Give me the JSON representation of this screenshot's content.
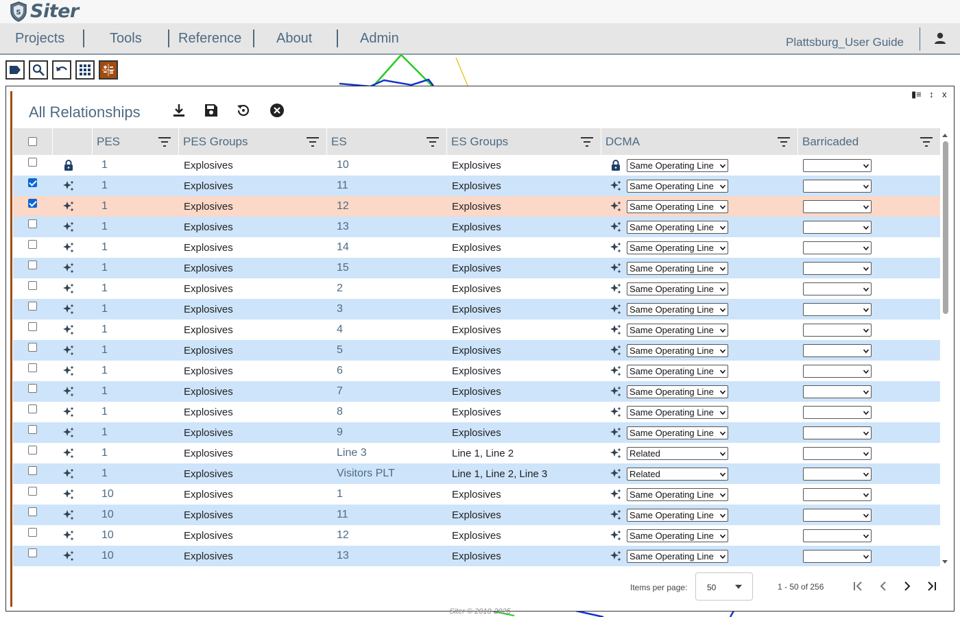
{
  "app": {
    "name": "Siter"
  },
  "nav": {
    "items": [
      "Projects",
      "Tools",
      "Reference",
      "About",
      "Admin"
    ],
    "project_name": "Plattsburg_User Guide"
  },
  "toolbar": {
    "tools": [
      "label-tool-icon",
      "search-icon",
      "undo-icon",
      "grid-icon",
      "calculator-icon"
    ]
  },
  "panel": {
    "title": "All Relationships",
    "controls": {
      "columns": "▮≡",
      "resize": "↕",
      "close": "x"
    },
    "actions": [
      "download-icon",
      "save-icon",
      "reset-icon",
      "cancel-icon"
    ]
  },
  "table": {
    "columns": [
      "PES",
      "PES Groups",
      "ES",
      "ES Groups",
      "DCMA",
      "Barricaded"
    ],
    "rows": [
      {
        "checked": false,
        "icon": "lock",
        "pes": "1",
        "pes_groups": "Explosives",
        "es": "10",
        "es_groups": "Explosives",
        "dcma_icon": "lock",
        "dcma": "Same Operating Line",
        "barricaded": ""
      },
      {
        "checked": true,
        "icon": "sparkle",
        "pes": "1",
        "pes_groups": "Explosives",
        "es": "11",
        "es_groups": "Explosives",
        "dcma_icon": "sparkle",
        "dcma": "Same Operating Line",
        "barricaded": ""
      },
      {
        "checked": true,
        "icon": "sparkle",
        "pes": "1",
        "pes_groups": "Explosives",
        "es": "12",
        "es_groups": "Explosives",
        "dcma_icon": "sparkle",
        "dcma": "Same Operating Line",
        "barricaded": "",
        "highlight": true
      },
      {
        "checked": false,
        "icon": "sparkle",
        "pes": "1",
        "pes_groups": "Explosives",
        "es": "13",
        "es_groups": "Explosives",
        "dcma_icon": "sparkle",
        "dcma": "Same Operating Line",
        "barricaded": ""
      },
      {
        "checked": false,
        "icon": "sparkle",
        "pes": "1",
        "pes_groups": "Explosives",
        "es": "14",
        "es_groups": "Explosives",
        "dcma_icon": "sparkle",
        "dcma": "Same Operating Line",
        "barricaded": ""
      },
      {
        "checked": false,
        "icon": "sparkle",
        "pes": "1",
        "pes_groups": "Explosives",
        "es": "15",
        "es_groups": "Explosives",
        "dcma_icon": "sparkle",
        "dcma": "Same Operating Line",
        "barricaded": ""
      },
      {
        "checked": false,
        "icon": "sparkle",
        "pes": "1",
        "pes_groups": "Explosives",
        "es": "2",
        "es_groups": "Explosives",
        "dcma_icon": "sparkle",
        "dcma": "Same Operating Line",
        "barricaded": ""
      },
      {
        "checked": false,
        "icon": "sparkle",
        "pes": "1",
        "pes_groups": "Explosives",
        "es": "3",
        "es_groups": "Explosives",
        "dcma_icon": "sparkle",
        "dcma": "Same Operating Line",
        "barricaded": ""
      },
      {
        "checked": false,
        "icon": "sparkle",
        "pes": "1",
        "pes_groups": "Explosives",
        "es": "4",
        "es_groups": "Explosives",
        "dcma_icon": "sparkle",
        "dcma": "Same Operating Line",
        "barricaded": ""
      },
      {
        "checked": false,
        "icon": "sparkle",
        "pes": "1",
        "pes_groups": "Explosives",
        "es": "5",
        "es_groups": "Explosives",
        "dcma_icon": "sparkle",
        "dcma": "Same Operating Line",
        "barricaded": ""
      },
      {
        "checked": false,
        "icon": "sparkle",
        "pes": "1",
        "pes_groups": "Explosives",
        "es": "6",
        "es_groups": "Explosives",
        "dcma_icon": "sparkle",
        "dcma": "Same Operating Line",
        "barricaded": ""
      },
      {
        "checked": false,
        "icon": "sparkle",
        "pes": "1",
        "pes_groups": "Explosives",
        "es": "7",
        "es_groups": "Explosives",
        "dcma_icon": "sparkle",
        "dcma": "Same Operating Line",
        "barricaded": ""
      },
      {
        "checked": false,
        "icon": "sparkle",
        "pes": "1",
        "pes_groups": "Explosives",
        "es": "8",
        "es_groups": "Explosives",
        "dcma_icon": "sparkle",
        "dcma": "Same Operating Line",
        "barricaded": ""
      },
      {
        "checked": false,
        "icon": "sparkle",
        "pes": "1",
        "pes_groups": "Explosives",
        "es": "9",
        "es_groups": "Explosives",
        "dcma_icon": "sparkle",
        "dcma": "Same Operating Line",
        "barricaded": ""
      },
      {
        "checked": false,
        "icon": "sparkle",
        "pes": "1",
        "pes_groups": "Explosives",
        "es": "Line 3",
        "es_groups": "Line 1, Line 2",
        "dcma_icon": "sparkle",
        "dcma": "Related",
        "barricaded": ""
      },
      {
        "checked": false,
        "icon": "sparkle",
        "pes": "1",
        "pes_groups": "Explosives",
        "es": "Visitors PLT",
        "es_groups": "Line 1, Line 2, Line 3",
        "dcma_icon": "sparkle",
        "dcma": "Related",
        "barricaded": ""
      },
      {
        "checked": false,
        "icon": "sparkle",
        "pes": "10",
        "pes_groups": "Explosives",
        "es": "1",
        "es_groups": "Explosives",
        "dcma_icon": "sparkle",
        "dcma": "Same Operating Line",
        "barricaded": ""
      },
      {
        "checked": false,
        "icon": "sparkle",
        "pes": "10",
        "pes_groups": "Explosives",
        "es": "11",
        "es_groups": "Explosives",
        "dcma_icon": "sparkle",
        "dcma": "Same Operating Line",
        "barricaded": ""
      },
      {
        "checked": false,
        "icon": "sparkle",
        "pes": "10",
        "pes_groups": "Explosives",
        "es": "12",
        "es_groups": "Explosives",
        "dcma_icon": "sparkle",
        "dcma": "Same Operating Line",
        "barricaded": ""
      },
      {
        "checked": false,
        "icon": "sparkle",
        "pes": "10",
        "pes_groups": "Explosives",
        "es": "13",
        "es_groups": "Explosives",
        "dcma_icon": "sparkle",
        "dcma": "Same Operating Line",
        "barricaded": ""
      }
    ]
  },
  "paginator": {
    "items_per_page_label": "Items per page:",
    "items_per_page": "50",
    "range": "1 - 50 of 256"
  },
  "footer": {
    "copyright": "Siter © 2010-2025"
  },
  "colors": {
    "brand": "#4e6a82",
    "row_alt": "#cde4fa",
    "row_highlight": "#fbd8c8",
    "accent_bar": "#a14c10"
  }
}
